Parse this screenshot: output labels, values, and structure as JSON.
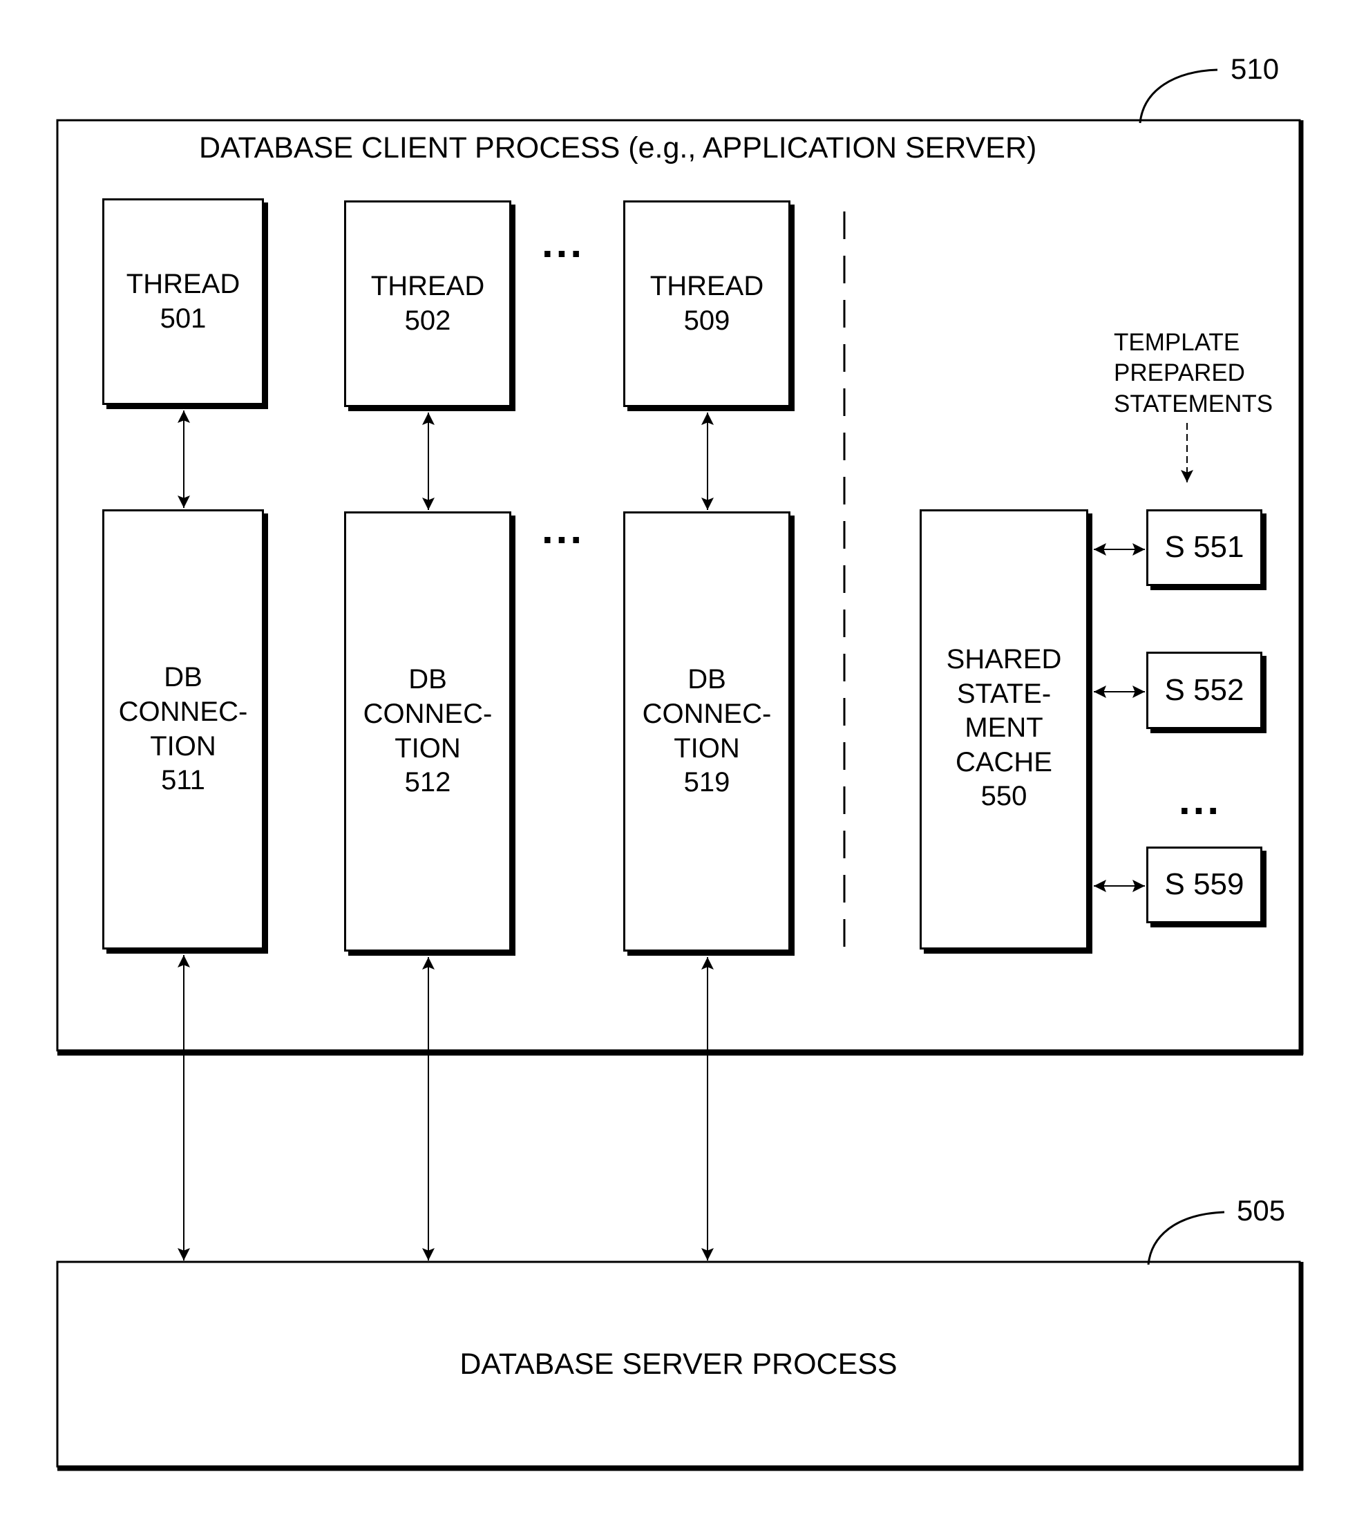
{
  "diagram": {
    "client_process": {
      "title": "DATABASE CLIENT PROCESS (e.g., APPLICATION SERVER)",
      "ref": "510"
    },
    "threads": [
      {
        "label": "THREAD\n501"
      },
      {
        "label": "THREAD\n502"
      },
      {
        "label": "THREAD\n509"
      }
    ],
    "connections": [
      {
        "label": "DB\nCONNEC-\nTION\n511"
      },
      {
        "label": "DB\nCONNEC-\nTION\n512"
      },
      {
        "label": "DB\nCONNEC-\nTION\n519"
      }
    ],
    "ellipsis": "...",
    "shared_cache": {
      "label": "SHARED\nSTATE-\nMENT\nCACHE\n550"
    },
    "template_note": "TEMPLATE\nPREPARED\nSTATEMENTS",
    "statements": [
      {
        "label": "S 551"
      },
      {
        "label": "S 552"
      },
      {
        "label": "S 559"
      }
    ],
    "server_process": {
      "title": "DATABASE SERVER PROCESS",
      "ref": "505"
    }
  }
}
